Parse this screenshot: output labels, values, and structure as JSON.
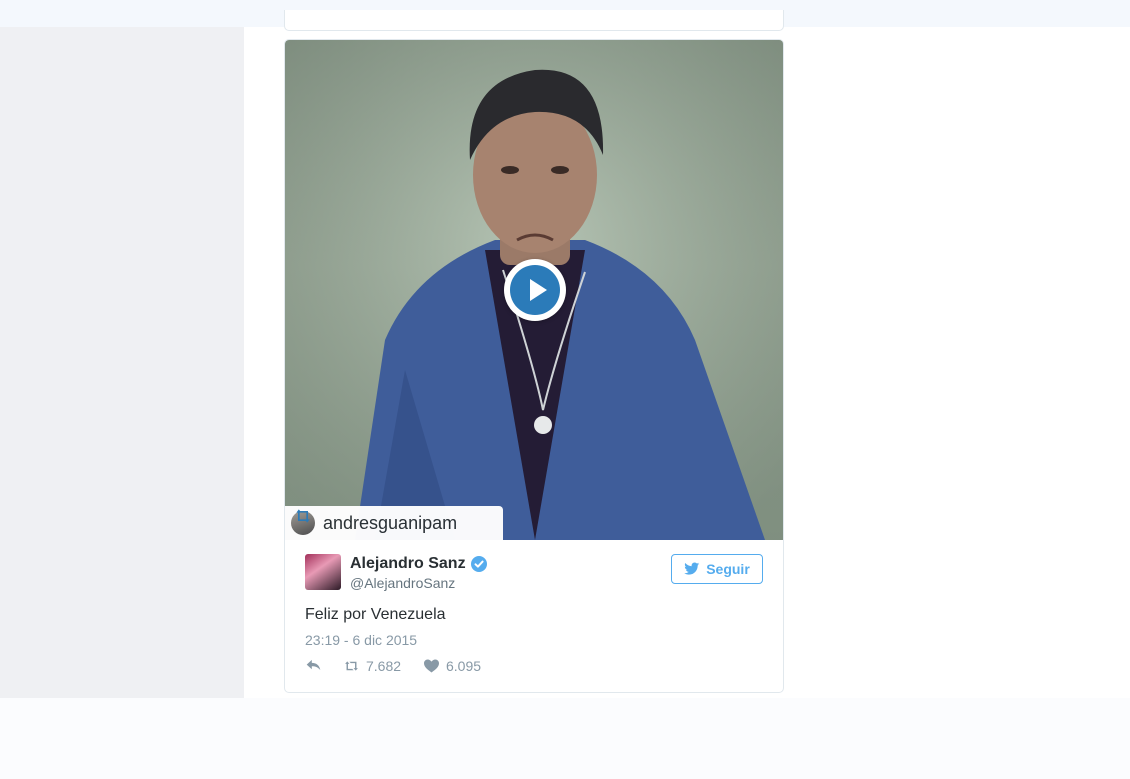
{
  "embed": {
    "attribution": {
      "username": "andresguanipam"
    },
    "author": {
      "display_name": "Alejandro Sanz",
      "handle": "@AlejandroSanz",
      "verified": true
    },
    "follow_button_label": "Seguir",
    "text": "Feliz por Venezuela",
    "timestamp": "23:19 - 6 dic 2015",
    "stats": {
      "retweets": "7.682",
      "likes": "6.095"
    }
  },
  "icons": {
    "play": "play-icon",
    "retweet": "retweet-icon",
    "reply": "reply-icon",
    "like": "heart-icon",
    "bird": "twitter-bird-icon",
    "verified": "verified-badge-icon"
  },
  "colors": {
    "accent": "#55acee",
    "play_button": "#2b7bb9",
    "muted_text": "#8899a6",
    "text": "#292f33"
  }
}
